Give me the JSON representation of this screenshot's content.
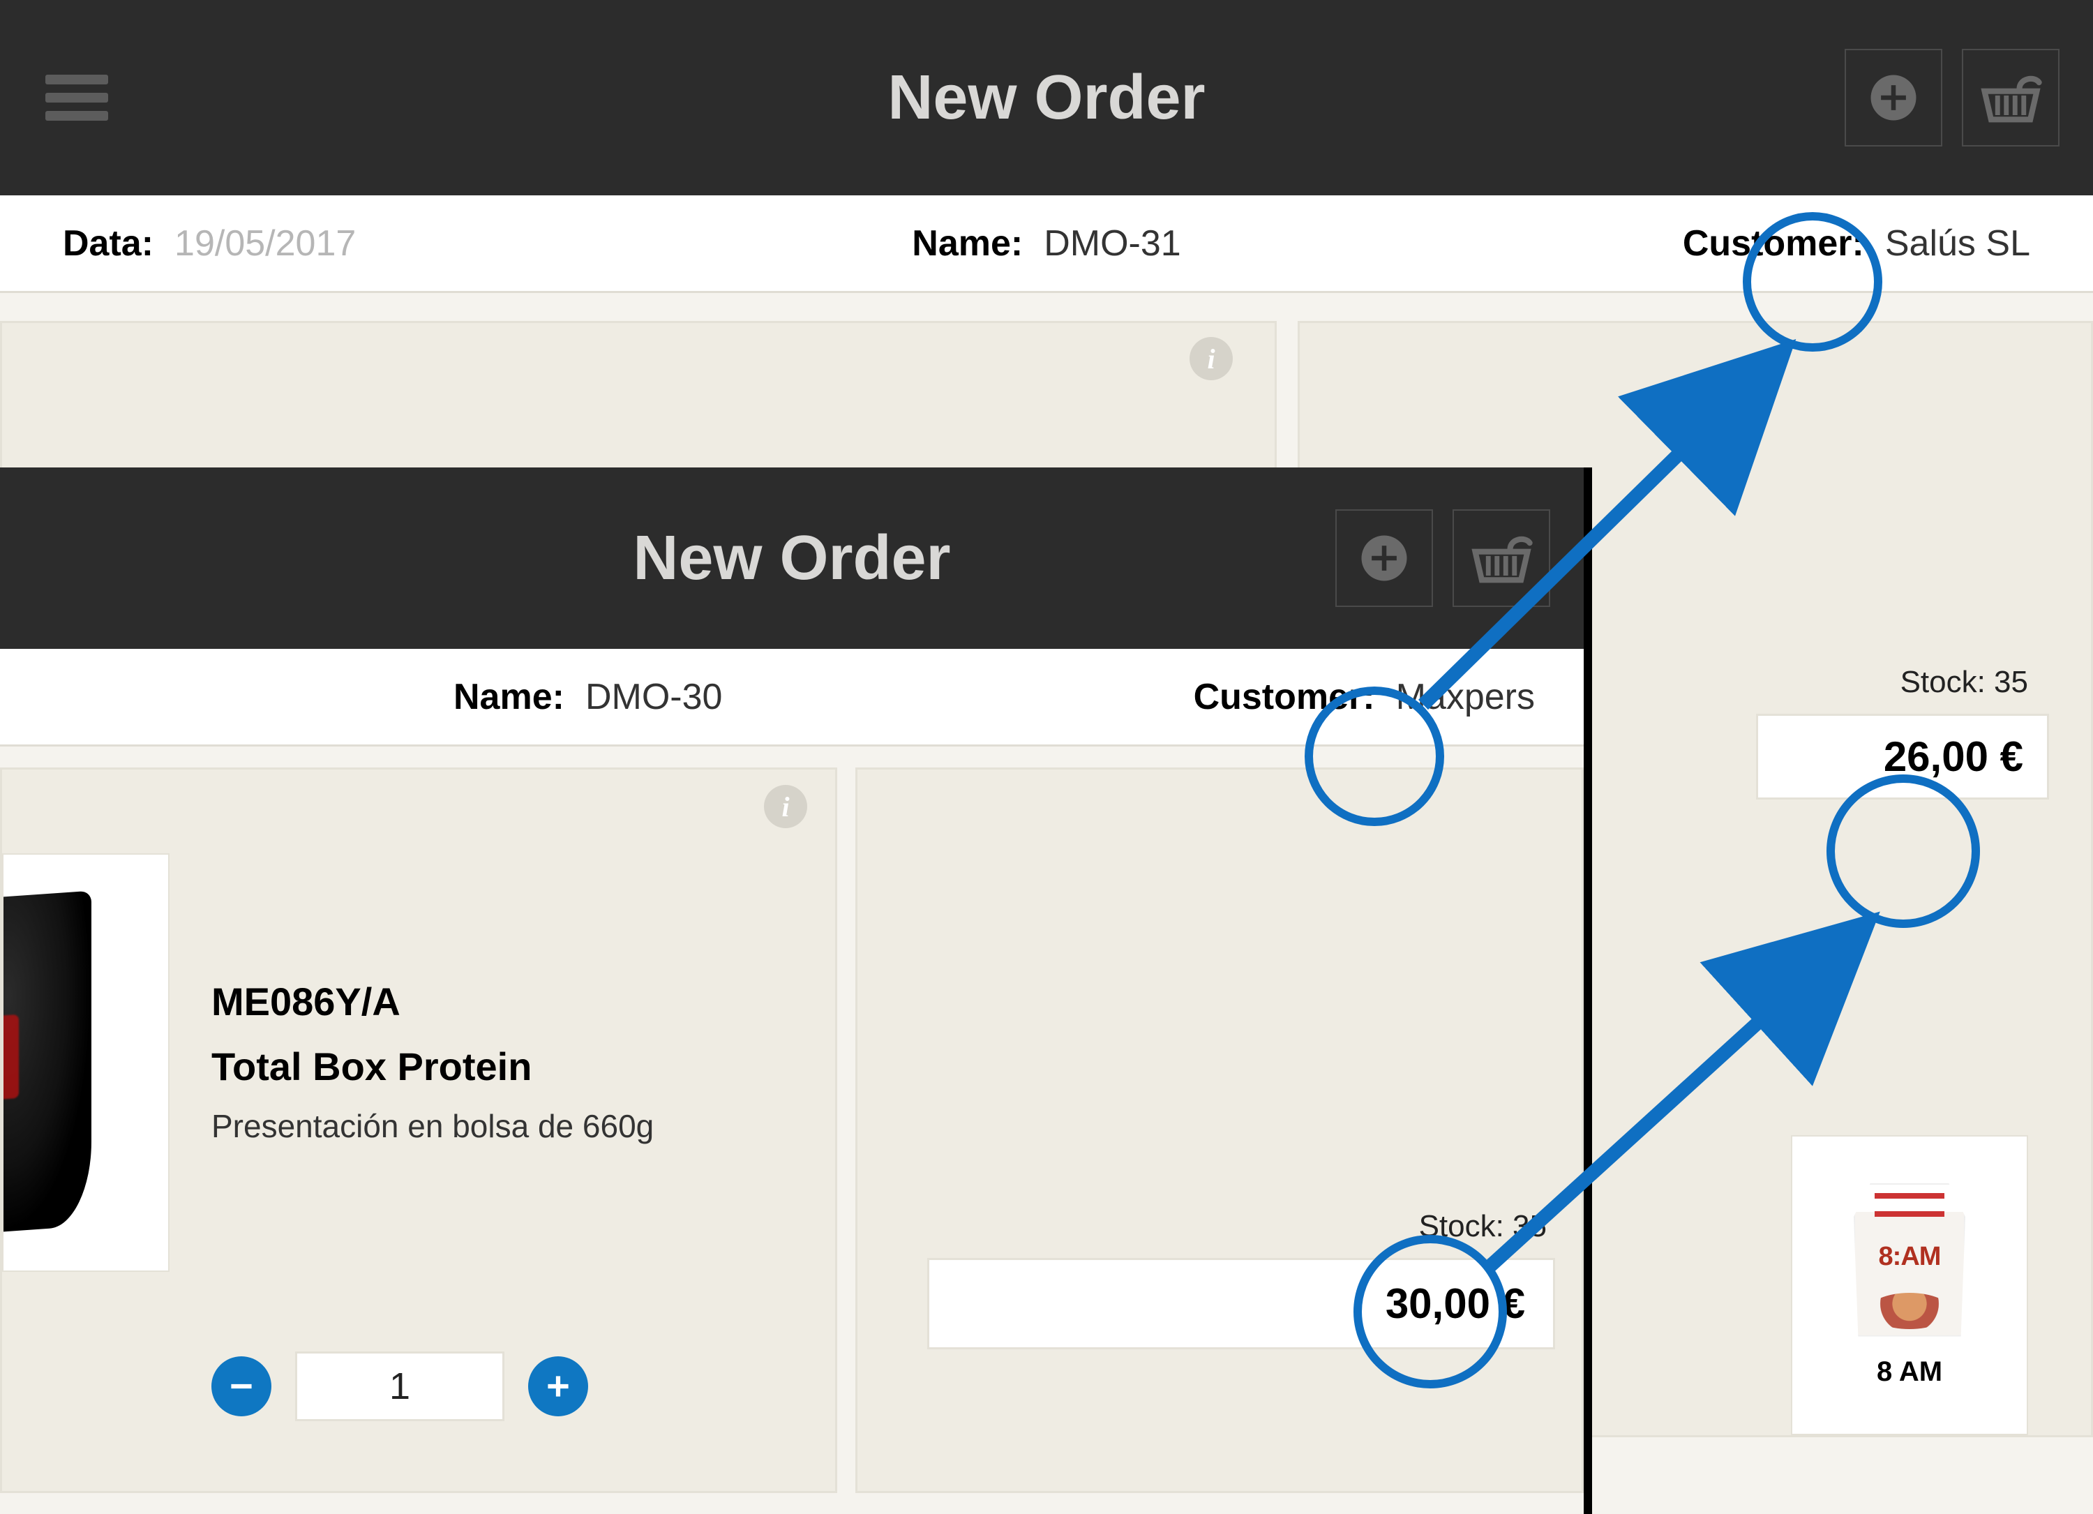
{
  "back": {
    "title": "New Order",
    "info": {
      "data_label": "Data:",
      "data_value": "19/05/2017",
      "name_label": "Name:",
      "name_value": "DMO-31",
      "customer_label": "Customer:",
      "customer_value": "Salús SL"
    },
    "right_card": {
      "stock_label": "Stock: 35",
      "price": "26,00 €",
      "mini_name": "8 AM",
      "mini_logo": "8:AM"
    }
  },
  "front": {
    "title": "New Order",
    "info": {
      "name_label": "Name:",
      "name_value": "DMO-30",
      "customer_label": "Customer:",
      "customer_value": "Maxpers"
    },
    "product": {
      "sku": "ME086Y/A",
      "name": "Total Box Protein",
      "desc": "Presentación en bolsa de 660g",
      "qty": "1"
    },
    "right_card": {
      "stock_label": "Stock: 35",
      "price": "30,00 €"
    }
  },
  "icons": {
    "info_i": "i"
  }
}
